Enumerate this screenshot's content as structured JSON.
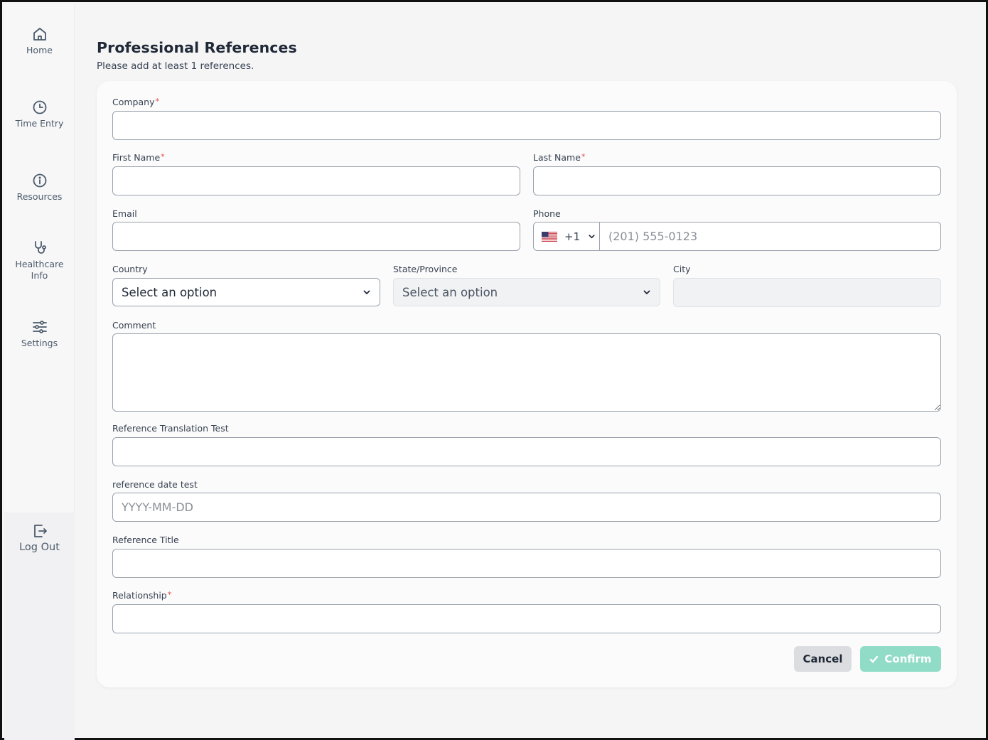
{
  "sidebar": {
    "items": [
      {
        "label": "Home",
        "icon": "home-icon"
      },
      {
        "label": "Time Entry",
        "icon": "clock-icon"
      },
      {
        "label": "Resources",
        "icon": "info-icon"
      },
      {
        "label": "Healthcare",
        "label2": "Info",
        "icon": "stethoscope-icon"
      },
      {
        "label": "Settings",
        "icon": "sliders-icon"
      }
    ],
    "logout": {
      "label": "Log Out",
      "icon": "logout-icon"
    }
  },
  "page": {
    "title": "Professional References",
    "subtitle": "Please add at least 1 references."
  },
  "form": {
    "company": {
      "label": "Company",
      "required": "*",
      "value": ""
    },
    "first_name": {
      "label": "First Name",
      "required": "*",
      "value": ""
    },
    "last_name": {
      "label": "Last Name",
      "required": "*",
      "value": ""
    },
    "email": {
      "label": "Email",
      "value": ""
    },
    "phone": {
      "label": "Phone",
      "country_code": "+1",
      "flag": "us-flag-icon",
      "placeholder": "(201) 555-0123"
    },
    "country": {
      "label": "Country",
      "selected": "Select an option"
    },
    "state": {
      "label": "State/Province",
      "selected": "Select an option"
    },
    "city": {
      "label": "City",
      "value": ""
    },
    "comment": {
      "label": "Comment",
      "value": ""
    },
    "translation_test": {
      "label": "Reference Translation Test",
      "value": ""
    },
    "date_test": {
      "label": "reference date test",
      "placeholder": "YYYY-MM-DD"
    },
    "reference_title": {
      "label": "Reference Title",
      "value": ""
    },
    "relationship": {
      "label": "Relationship",
      "required": "*",
      "value": ""
    }
  },
  "actions": {
    "cancel_label": "Cancel",
    "confirm_label": "Confirm"
  },
  "colors": {
    "accent_disabled": "#90dcc7",
    "required": "#e24a4a",
    "sidebar_text": "#4b5a6b"
  }
}
